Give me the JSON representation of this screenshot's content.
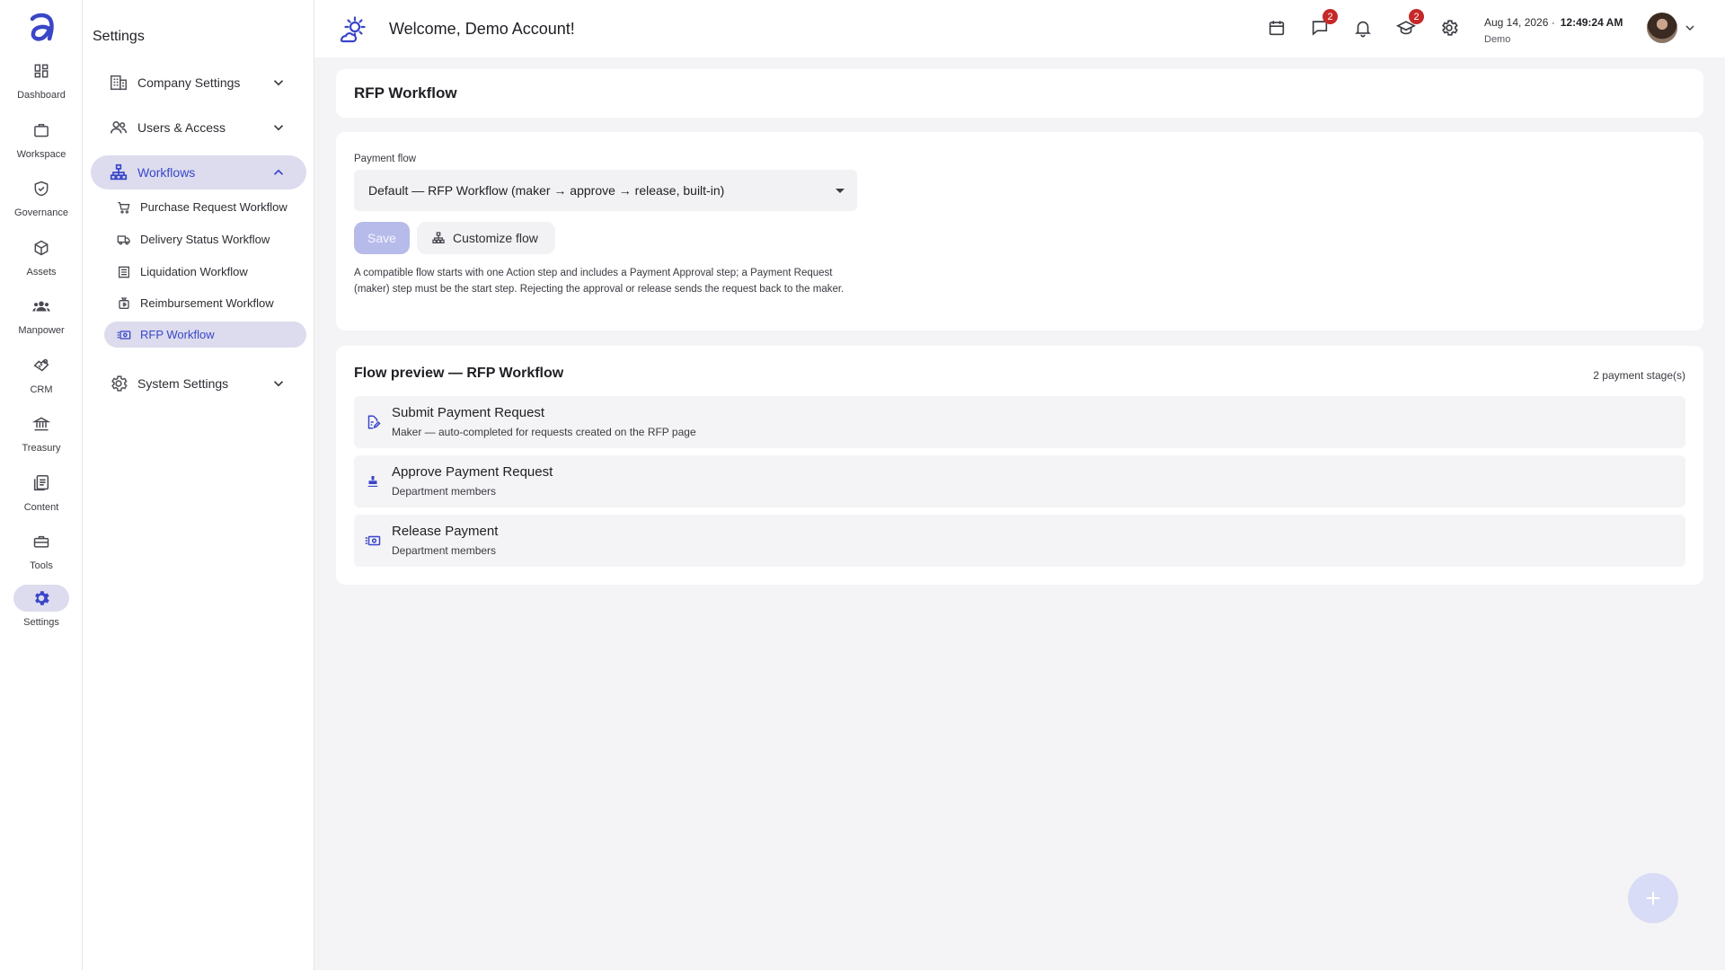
{
  "rail": {
    "items": [
      {
        "label": "Dashboard",
        "icon": "dashboard-icon"
      },
      {
        "label": "Workspace",
        "icon": "briefcase-icon"
      },
      {
        "label": "Governance",
        "icon": "shield-check-icon"
      },
      {
        "label": "Assets",
        "icon": "box-icon"
      },
      {
        "label": "Manpower",
        "icon": "people-icon"
      },
      {
        "label": "CRM",
        "icon": "handshake-icon"
      },
      {
        "label": "Treasury",
        "icon": "bank-icon"
      },
      {
        "label": "Content",
        "icon": "documents-icon"
      },
      {
        "label": "Tools",
        "icon": "toolbox-icon"
      },
      {
        "label": "Settings",
        "icon": "gear-icon"
      }
    ],
    "active": "Settings"
  },
  "panel": {
    "title": "Settings",
    "groups": {
      "company": "Company Settings",
      "users": "Users & Access",
      "workflows": "Workflows",
      "system": "System Settings"
    },
    "workflow_items": [
      "Purchase Request Workflow",
      "Delivery Status Workflow",
      "Liquidation Workflow",
      "Reimbursement Workflow",
      "RFP Workflow"
    ],
    "active_item": "RFP Workflow"
  },
  "header": {
    "welcome": "Welcome, Demo Account!",
    "messages_badge": "2",
    "training_badge": "2",
    "date": "Aug 14, 2026 ·",
    "time": "12:49:24 AM",
    "user": "Demo"
  },
  "page": {
    "title": "RFP Workflow",
    "payment_flow_label": "Payment flow",
    "payment_flow_value": "Default — RFP Workflow (maker → approve → release, built-in)",
    "save_label": "Save",
    "customize_label": "Customize flow",
    "help_text": "A compatible flow starts with one Action step and includes a Payment Approval step; a Payment Request (maker) step must be the start step. Rejecting the approval or release sends the request back to the maker."
  },
  "preview": {
    "title": "Flow preview — RFP Workflow",
    "stage_count": "2 payment stage(s)",
    "steps": [
      {
        "title": "Submit Payment Request",
        "subtitle": "Maker — auto-completed for requests created on the RFP page"
      },
      {
        "title": "Approve Payment Request",
        "subtitle": "Department members"
      },
      {
        "title": "Release Payment",
        "subtitle": "Department members"
      }
    ]
  },
  "colors": {
    "accent": "#3a46c8",
    "active_bg": "#dcdcee",
    "badge": "#c62828"
  }
}
